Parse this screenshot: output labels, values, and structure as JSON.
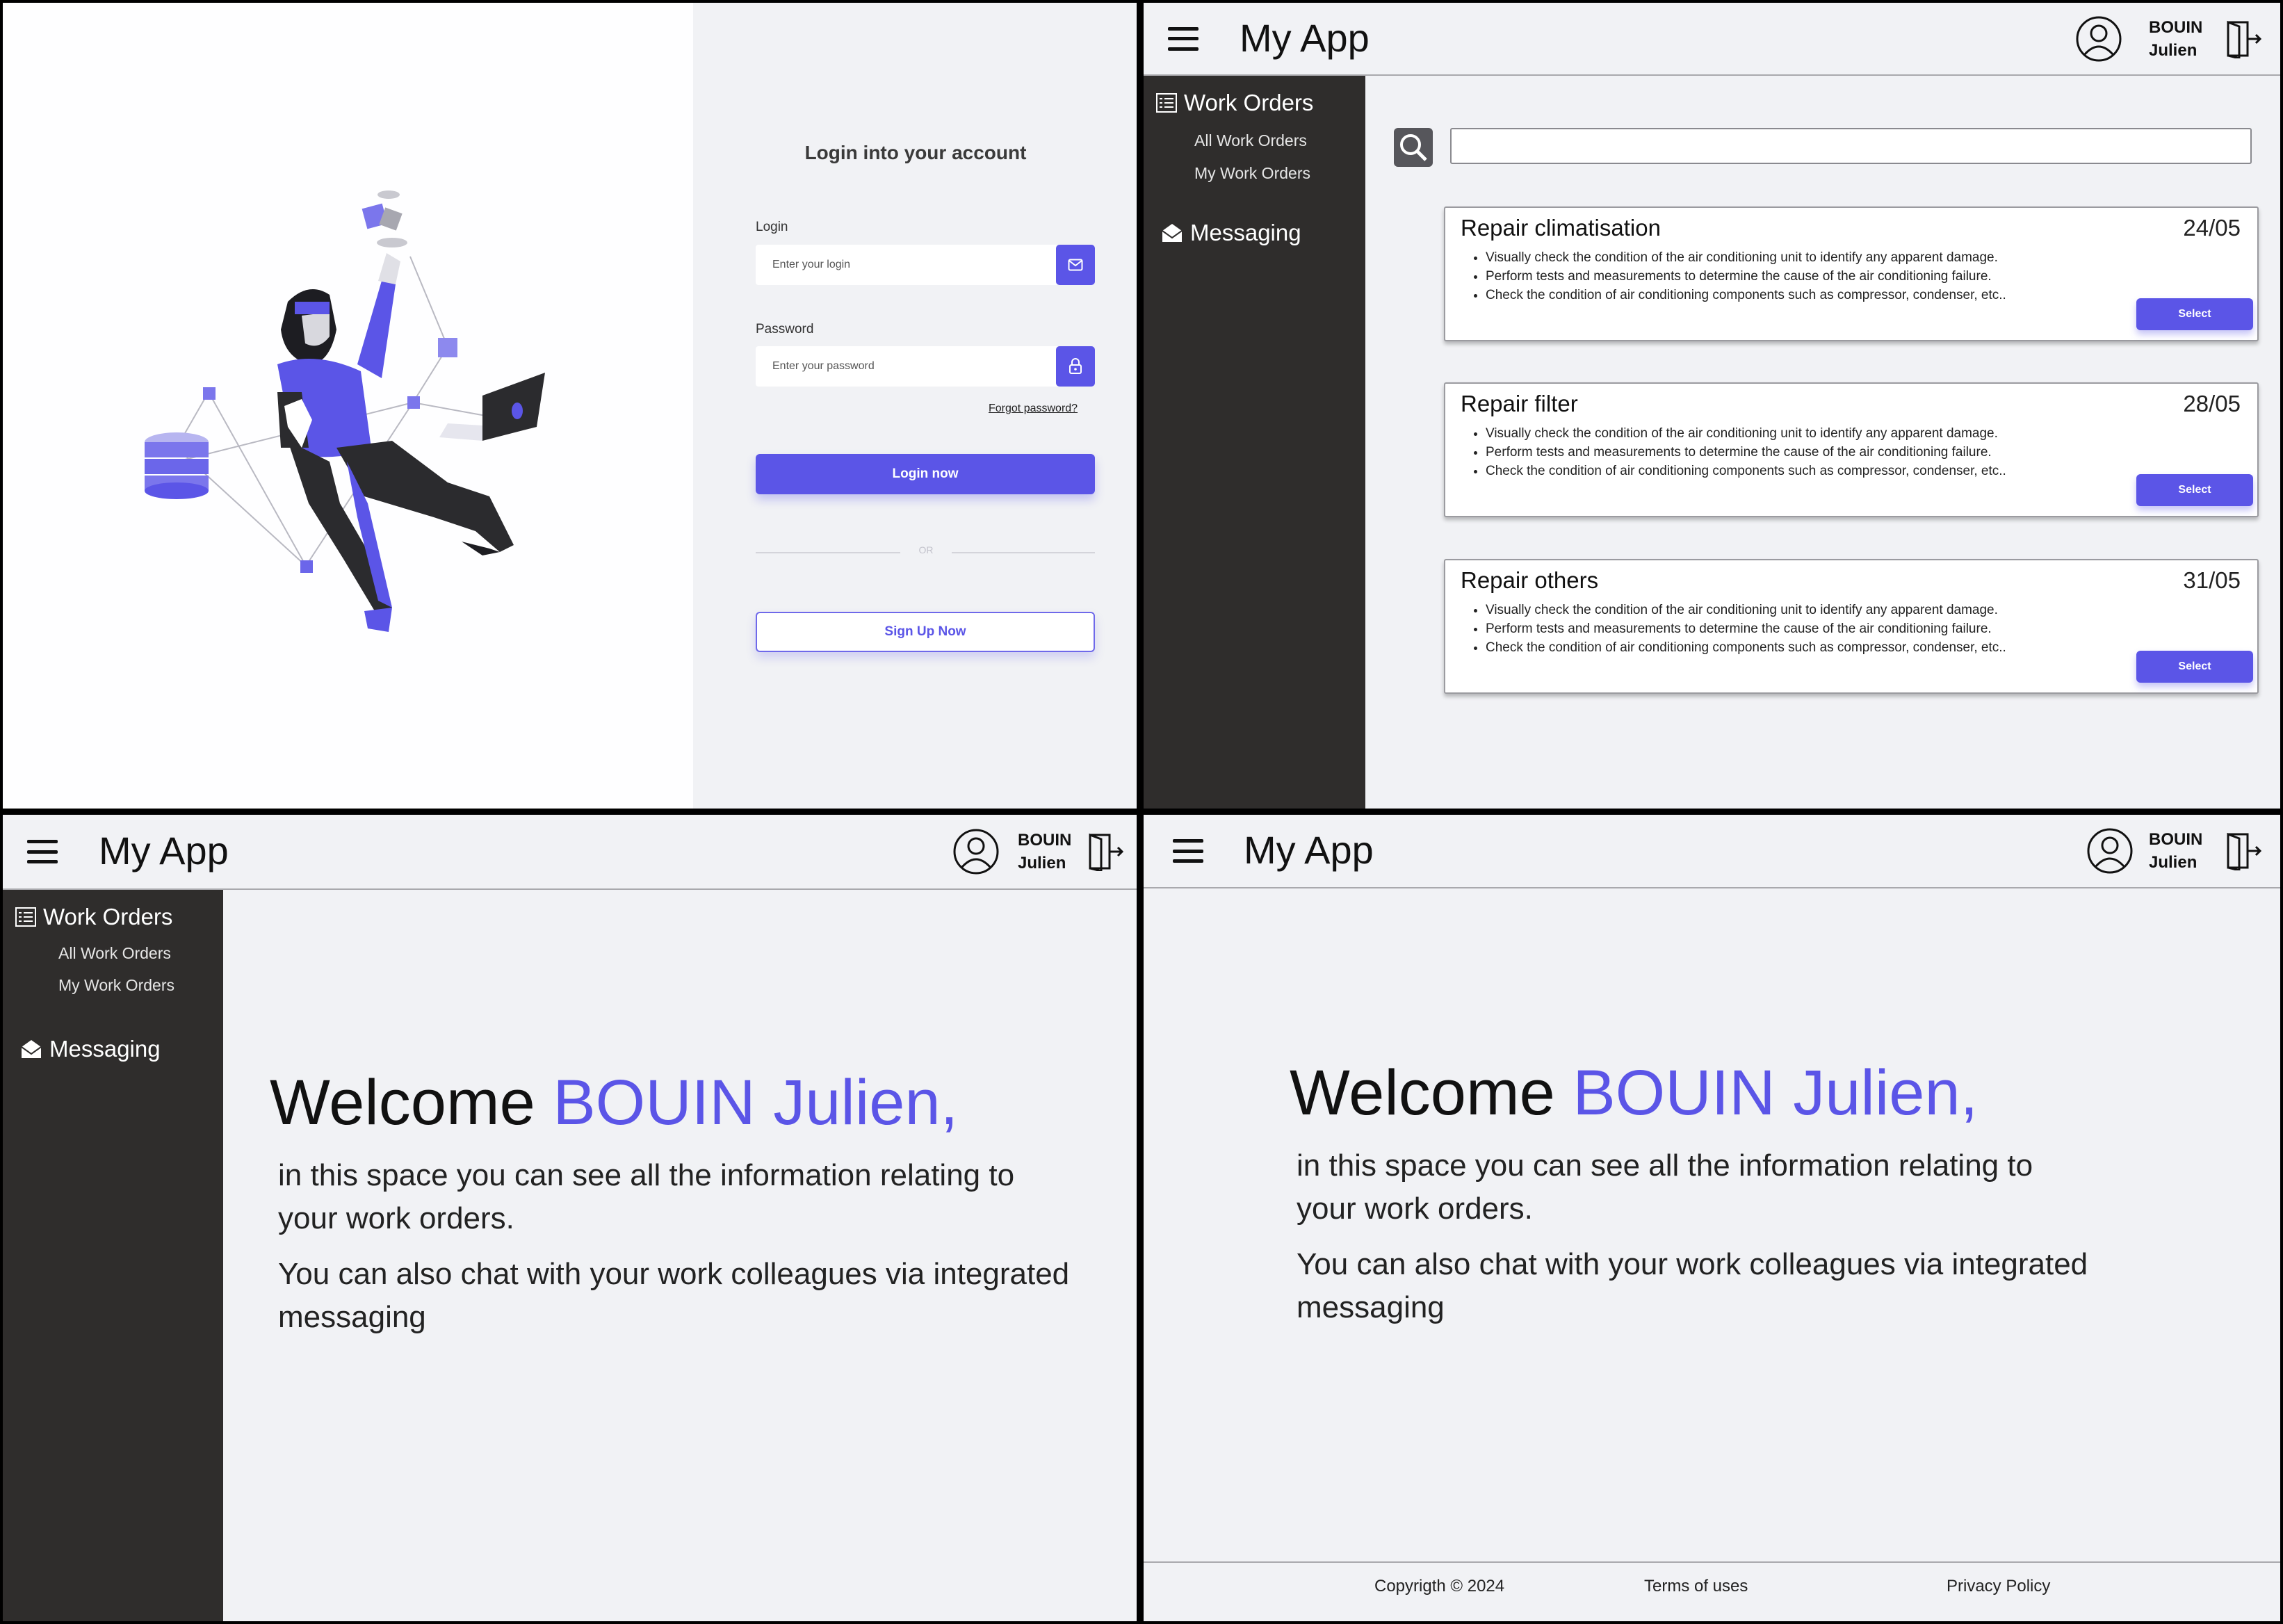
{
  "login": {
    "title": "Login into your account",
    "login_label": "Login",
    "login_placeholder": "Enter your login",
    "password_label": "Password",
    "password_placeholder": "Enter your password",
    "forgot": "Forgot password?",
    "login_button": "Login now",
    "or": "OR",
    "signup_button": "Sign Up Now"
  },
  "app": {
    "title": "My App",
    "user_last": "BOUIN",
    "user_first": "Julien"
  },
  "sidebar": {
    "work_orders": "Work Orders",
    "all_work_orders": "All Work Orders",
    "my_work_orders": "My Work Orders",
    "messaging": "Messaging"
  },
  "work_orders": [
    {
      "title": "Repair climatisation",
      "date": "24/05",
      "select": "Select",
      "items": [
        "Visually check the condition of the air conditioning unit to identify any apparent damage.",
        "Perform tests and measurements to determine the cause of the air conditioning failure.",
        "Check the condition of air conditioning components such as compressor, condenser, etc.."
      ]
    },
    {
      "title": "Repair filter",
      "date": "28/05",
      "select": "Select",
      "items": [
        "Visually check the condition of the air conditioning unit to identify any apparent damage.",
        "Perform tests and measurements to determine the cause of the air conditioning failure.",
        "Check the condition of air conditioning components such as compressor, condenser, etc.."
      ]
    },
    {
      "title": "Repair others",
      "date": "31/05",
      "select": "Select",
      "items": [
        "Visually check the condition of the air conditioning unit to identify any apparent damage.",
        "Perform tests and measurements to determine the cause of the air conditioning failure.",
        "Check the condition of air conditioning components such as compressor, condenser, etc.."
      ]
    }
  ],
  "welcome": {
    "word": "Welcome",
    "name": "BOUIN Julien,",
    "line1": "in this space you can see all the information relating to your work orders.",
    "line2": "You can also chat with your work colleagues via integrated messaging"
  },
  "footer": {
    "copyright": "Copyrigth © 2024",
    "terms": "Terms of uses",
    "privacy": "Privacy Policy"
  },
  "colors": {
    "accent": "#5b55e7",
    "sidebar": "#2f2d2c",
    "background": "#f1f2f5"
  }
}
